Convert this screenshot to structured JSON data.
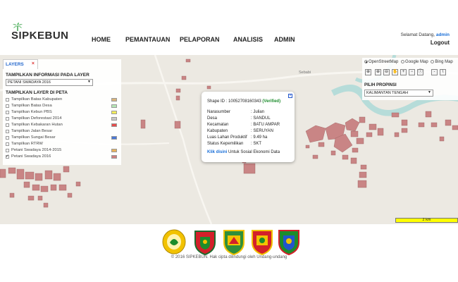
{
  "brand": {
    "name": "SIPKEBUN"
  },
  "nav": {
    "items": [
      "HOME",
      "PEMANTAUAN",
      "PELAPORAN",
      "ANALISIS",
      "ADMIN"
    ]
  },
  "user": {
    "greeting": "Selamat Datang,",
    "username": "admin",
    "logout": "Logout"
  },
  "layers_panel": {
    "tab_label": "LAYERS",
    "close_label": "×",
    "info_title": "TAMPILKAN INFORMASI PADA LAYER",
    "info_select_value": "PETANI SWADAYA 2016",
    "layer_title": "TAMPILKAN LAYER DI PETA",
    "layers": [
      {
        "label": "Tampilkan Batas Kabupaten",
        "checked": false,
        "color": "#d9b47a"
      },
      {
        "label": "Tampilkan Batas Desa",
        "checked": false,
        "color": "#b5e6b5"
      },
      {
        "label": "Tampilkan Kebun PBS",
        "checked": false,
        "color": "#f2ee5a"
      },
      {
        "label": "Tampilkan Deforestasi 2014",
        "checked": false,
        "color": "#c8c8c8"
      },
      {
        "label": "Tampilkan Kebakaran Hutan",
        "checked": false,
        "color": "#e64c4c"
      },
      {
        "label": "Tampilkan Jalan Besar",
        "checked": false,
        "color": null
      },
      {
        "label": "Tampilkan Sungai Besar",
        "checked": false,
        "color": "#4a78d6"
      },
      {
        "label": "Tampilkan RTRW",
        "checked": false,
        "color": null
      },
      {
        "label": "Petani Swadaya 2014-2015",
        "checked": false,
        "color": "#e8b25c"
      },
      {
        "label": "Petani Swadaya 2016",
        "checked": true,
        "color": "#cf7f7f"
      }
    ]
  },
  "map_controls": {
    "base_maps": [
      {
        "label": "OpenStreetMap",
        "selected": true
      },
      {
        "label": "Google Map",
        "selected": false
      },
      {
        "label": "Bing Map",
        "selected": false
      }
    ],
    "province_label": "PILIH PROPINSI",
    "province_value": "KALIMANTAN TENGAH"
  },
  "popup": {
    "shape_prefix": "Shape ID : 10052708160343",
    "verified": "(Verified)",
    "rows": [
      {
        "key": "Narasumber",
        "value": ": Julian"
      },
      {
        "key": "Desa",
        "value": ": SANDUL"
      },
      {
        "key": "Kecamatan",
        "value": ": BATU AMPAR"
      },
      {
        "key": "Kabupaten",
        "value": ": SERUYAN"
      },
      {
        "key": "Luas Lahan Produktif",
        "value": ": 9.49 ha"
      },
      {
        "key": "Status Kepemilikan",
        "value": ": SKT"
      }
    ],
    "link_text": "Klik disini",
    "link_suffix": " Untuk Sosial Ekonomi Data"
  },
  "map": {
    "place_label": "Sebabi",
    "scale_label": "2 km",
    "plot_color": "#c98585",
    "river_color": "#b6dcd9"
  },
  "footer": {
    "copyright": "© 2016 SIPKEBUN. Hak cipta dilindungi oleh Undang-undang"
  }
}
